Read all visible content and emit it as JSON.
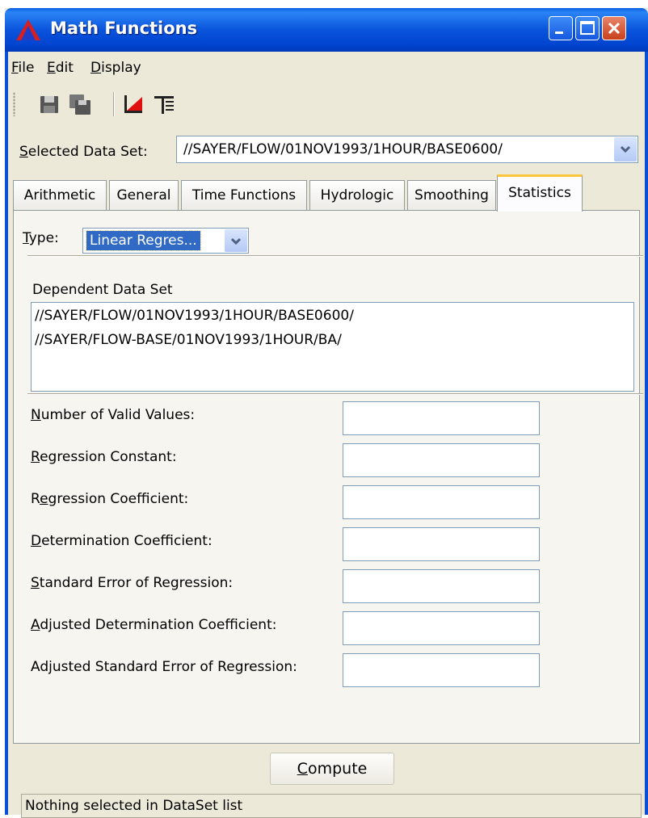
{
  "window": {
    "title": "Math Functions",
    "colors": {
      "titlebar": "#0a54dc",
      "close": "#c8401c",
      "tab_highlight": "#ffc83c",
      "selection": "#316ac5"
    }
  },
  "menu": {
    "file": {
      "mnemonic": "F",
      "rest": "ile"
    },
    "edit": {
      "mnemonic": "E",
      "rest": "dit"
    },
    "display": {
      "mnemonic": "D",
      "rest": "isplay"
    }
  },
  "toolbar": {
    "icons": [
      "save-icon",
      "save-all-icon",
      "plot-icon",
      "tabulate-icon"
    ]
  },
  "dataset": {
    "label_mnemonic": "S",
    "label_rest": "elected Data Set:",
    "value": "//SAYER/FLOW/01NOV1993/1HOUR/BASE0600/"
  },
  "tabs": [
    {
      "label": "Arithmetic"
    },
    {
      "label": "General"
    },
    {
      "label": "Time Functions"
    },
    {
      "label": "Hydrologic"
    },
    {
      "label": "Smoothing"
    },
    {
      "label": "Statistics",
      "active": true
    }
  ],
  "statistics": {
    "type_label_mnemonic": "T",
    "type_label_rest": "ype:",
    "type_value": "Linear Regres...",
    "dependent_label": "Dependent Data Set",
    "dependent_items": [
      "//SAYER/FLOW/01NOV1993/1HOUR/BASE0600/",
      "//SAYER/FLOW-BASE/01NOV1993/1HOUR/BA/"
    ],
    "fields": [
      {
        "pre": "",
        "mn": "N",
        "post": "umber of Valid Values:",
        "value": ""
      },
      {
        "pre": "",
        "mn": "R",
        "post": "egression Constant:",
        "value": ""
      },
      {
        "pre": "R",
        "mn": "e",
        "post": "gression Coefficient:",
        "value": ""
      },
      {
        "pre": "",
        "mn": "D",
        "post": "etermination Coefficient:",
        "value": ""
      },
      {
        "pre": "",
        "mn": "S",
        "post": "tandard Error of Regression:",
        "value": ""
      },
      {
        "pre": "",
        "mn": "A",
        "post": "djusted Determination Coefficient:",
        "value": ""
      },
      {
        "pre": "Ad",
        "mn": "j",
        "post": "usted Standard Error of Regression:",
        "value": ""
      }
    ]
  },
  "compute": {
    "mnemonic": "C",
    "rest": "ompute"
  },
  "status": "Nothing selected in DataSet list"
}
